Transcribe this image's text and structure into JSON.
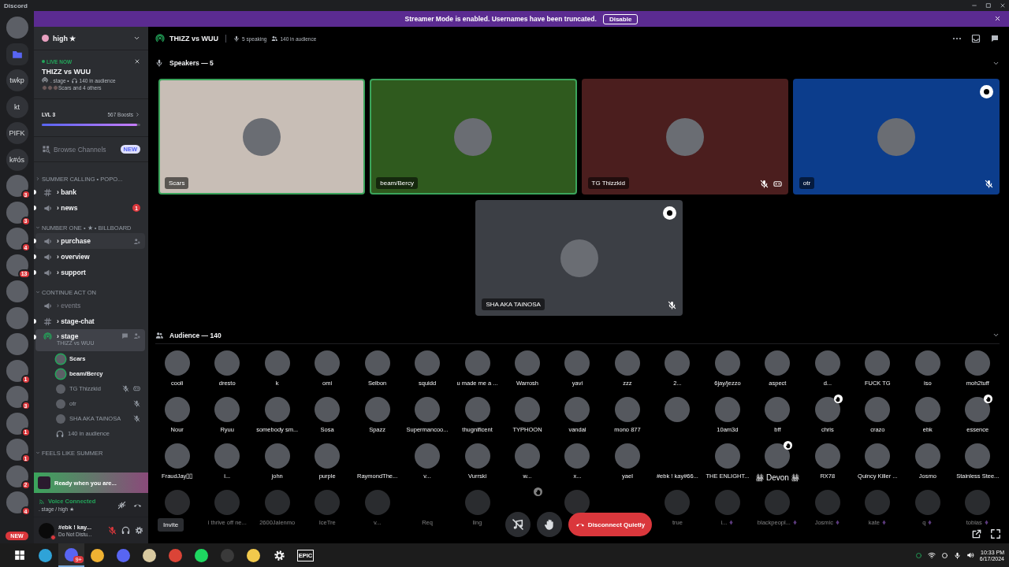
{
  "window": {
    "title": "Discord"
  },
  "banner": {
    "text": "Streamer Mode is enabled. Usernames have been truncated.",
    "button": "Disable"
  },
  "servers": [
    {
      "kind": "avatar"
    },
    {
      "kind": "folder"
    },
    {
      "kind": "text",
      "label": "twkp"
    },
    {
      "kind": "text",
      "label": "kt"
    },
    {
      "kind": "text",
      "label": "PIFK"
    },
    {
      "kind": "text",
      "label": "k#ós"
    },
    {
      "kind": "avatar",
      "badge": "3"
    },
    {
      "kind": "avatar",
      "badge": "3"
    },
    {
      "kind": "avatar",
      "badge": "4"
    },
    {
      "kind": "avatar",
      "badge": "13"
    },
    {
      "kind": "avatar"
    },
    {
      "kind": "avatar"
    },
    {
      "kind": "avatar"
    },
    {
      "kind": "avatar",
      "badge": "1"
    },
    {
      "kind": "avatar",
      "badge": "3"
    },
    {
      "kind": "avatar",
      "badge": "1"
    },
    {
      "kind": "avatar",
      "badge": "1"
    },
    {
      "kind": "avatar",
      "badge": "2"
    },
    {
      "kind": "avatar",
      "badge": "4"
    },
    {
      "kind": "new",
      "label": "NEW"
    }
  ],
  "server_header": {
    "name": "high ★"
  },
  "live_card": {
    "status": "LIVE NOW",
    "title": "THIZZ vs WUU",
    "channel": ". stage •",
    "audience": "140 in audience",
    "participants": "Scars and 4 others"
  },
  "boost": {
    "level_label": "LVL 3",
    "boosts": "567 Boosts",
    "level": 0.97
  },
  "browse": {
    "label": "Browse Channels",
    "badge": "NEW"
  },
  "categories": [
    {
      "name": "SUMMER CALLING • POPO...",
      "expanded": false,
      "channels": [
        {
          "kind": "text",
          "name": "› bank",
          "unread": true,
          "selected": false
        },
        {
          "kind": "announcement",
          "name": "› news",
          "unread": true,
          "selected": false,
          "badge": "1"
        }
      ]
    },
    {
      "name": "NUMBER ONE • ★ • BILLBOARD",
      "expanded": true,
      "channels": [
        {
          "kind": "announcement",
          "name": "› purchase",
          "unread": true,
          "selected": false,
          "hovered": true
        },
        {
          "kind": "announcement",
          "name": "› overview",
          "unread": true,
          "selected": false
        },
        {
          "kind": "announcement",
          "name": "› support",
          "unread": true,
          "selected": false
        }
      ]
    },
    {
      "name": "CONTINUE ACT ON",
      "expanded": true,
      "channels": [
        {
          "kind": "announcement",
          "name": "› events",
          "unread": false,
          "selected": false
        },
        {
          "kind": "text",
          "name": "› stage-chat",
          "unread": true,
          "selected": false
        },
        {
          "kind": "stage",
          "name": "› stage",
          "unread": true,
          "selected": true,
          "subtitle": "THIZZ vs WUU",
          "audience": "140 in audience",
          "members": [
            {
              "name": "Scars",
              "speaking": true,
              "muted": false,
              "vr": false
            },
            {
              "name": "beam/Bercy",
              "speaking": true,
              "muted": false,
              "vr": false
            },
            {
              "name": "TG Thizzkid",
              "speaking": false,
              "muted": true,
              "vr": true
            },
            {
              "name": "otr",
              "speaking": false,
              "muted": true,
              "vr": false
            },
            {
              "name": "SHA AKA TAiNOSA",
              "speaking": false,
              "muted": true,
              "vr": false
            }
          ]
        }
      ]
    },
    {
      "name": "FEELS LIKE SUMMER",
      "expanded": true
    }
  ],
  "notice": {
    "text": "Ready when you are..."
  },
  "voice": {
    "status": "Voice Connected",
    "channel": ". stage / high ★"
  },
  "user": {
    "name": "#ebk ! kay...",
    "status": "Do Not Distu...",
    "mic_muted": true
  },
  "stage": {
    "title": "THIZZ vs WUU",
    "speaking": "5 speaking",
    "audience": "140 in audience",
    "speakers_label": "Speakers — 5",
    "speakers": [
      {
        "name": "Scars",
        "color": "#c8beb6",
        "speaking": true,
        "muted": false,
        "vr": false,
        "badge": false
      },
      {
        "name": "beam/Bercy",
        "color": "#2f5a1e",
        "speaking": true,
        "muted": false,
        "vr": false,
        "badge": false
      },
      {
        "name": "TG Thizzkid",
        "color": "#4b1e1e",
        "speaking": false,
        "muted": true,
        "vr": true,
        "badge": false
      },
      {
        "name": "otr",
        "color": "#0c3d8c",
        "speaking": false,
        "muted": true,
        "vr": false,
        "badge": true
      },
      {
        "name": "SHA AKA TAiNOSA",
        "color": "#3c3f45",
        "speaking": false,
        "muted": true,
        "vr": false,
        "badge": true
      }
    ],
    "audience_label": "Audience — 140",
    "audience_rows": [
      [
        {
          "name": "cooli"
        },
        {
          "name": "dresto"
        },
        {
          "name": "k"
        },
        {
          "name": "omi"
        },
        {
          "name": "Selbon"
        },
        {
          "name": "squidd"
        },
        {
          "name": "u made me a ..."
        },
        {
          "name": "Warrosh"
        },
        {
          "name": "yavi"
        },
        {
          "name": "zzz"
        },
        {
          "name": "2..."
        },
        {
          "name": "6jay/jezzo"
        },
        {
          "name": "aspect"
        },
        {
          "name": "d..."
        },
        {
          "name": "FUCK TG"
        },
        {
          "name": "iso"
        },
        {
          "name": "moh2tuff"
        }
      ],
      [
        {
          "name": "Nour"
        },
        {
          "name": "Ryuu"
        },
        {
          "name": "somebody sm..."
        },
        {
          "name": "Sosa"
        },
        {
          "name": "Spazz"
        },
        {
          "name": "Supermancoo..."
        },
        {
          "name": "thugnificent"
        },
        {
          "name": "TYPHOON"
        },
        {
          "name": "vandal"
        },
        {
          "name": "mono 877"
        },
        {},
        {
          "name": "10am3d"
        },
        {
          "name": "bff"
        },
        {
          "name": "chris",
          "hand": true
        },
        {
          "name": "crazo"
        },
        {
          "name": "ebk"
        },
        {
          "name": "essence",
          "hand": true
        }
      ],
      [
        {
          "name": "FraudJay▯▯"
        },
        {
          "name": "i..."
        },
        {
          "name": "john"
        },
        {
          "name": "purple"
        },
        {
          "name": "RaymondThe...",
          "avatar": false
        },
        {
          "name": "v..."
        },
        {
          "name": "Vurrski"
        },
        {
          "name": "w..."
        },
        {
          "name": "x..."
        },
        {
          "name": "yael"
        },
        {
          "name": "#ebk ! kay#66...",
          "avatar": false
        },
        {
          "name": "THE ENLIGHT..."
        },
        {
          "name": "赫 Devon 赫",
          "hand": true
        },
        {
          "name": "RX78"
        },
        {
          "name": "Quincy Killer ..."
        },
        {
          "name": "Josmo"
        },
        {
          "name": "Stainless Stee..."
        }
      ],
      [
        {},
        {
          "name": "i thrive off ne..."
        },
        {
          "name": "2600Jalenmo"
        },
        {
          "name": "IceTre"
        },
        {
          "name": "v..."
        },
        {
          "name": "Req",
          "avatar": false
        },
        {
          "name": "ling"
        },
        {
          "avatar": false,
          "hand": true
        },
        {},
        {
          "avatar": false
        },
        {
          "name": "true"
        },
        {
          "name": "i...",
          "boost": true
        },
        {
          "name": "blackpeopl...",
          "boost": true
        },
        {
          "name": "Josmic",
          "boost": true
        },
        {
          "name": "kate",
          "boost": true
        },
        {
          "name": "q",
          "boost": true
        },
        {
          "name": "tobias",
          "boost": true
        }
      ]
    ]
  },
  "controls": {
    "invite": "Invite",
    "disconnect": "Disconnect Quietly"
  },
  "taskbar": {
    "apps": [
      {
        "kind": "windows"
      },
      {
        "kind": "app",
        "color": "#2fa3d8",
        "selected": false
      },
      {
        "kind": "app",
        "color": "#5865f2",
        "selected": true,
        "badge": "9+"
      },
      {
        "kind": "app",
        "color": "#f0b232",
        "selected": false
      },
      {
        "kind": "app",
        "color": "#5865f2",
        "selected": false
      },
      {
        "kind": "app",
        "color": "#d8c9a0",
        "selected": false
      },
      {
        "kind": "app",
        "color": "#db4437",
        "selected": false
      },
      {
        "kind": "app",
        "color": "#1ed760",
        "selected": false
      },
      {
        "kind": "app",
        "color": "#3a3a3a",
        "selected": false
      },
      {
        "kind": "app",
        "color": "#f2c94c",
        "selected": false
      },
      {
        "kind": "gear"
      },
      {
        "kind": "label",
        "label": "EPIC"
      }
    ],
    "time": "10:33 PM",
    "date": "6/17/2024"
  }
}
